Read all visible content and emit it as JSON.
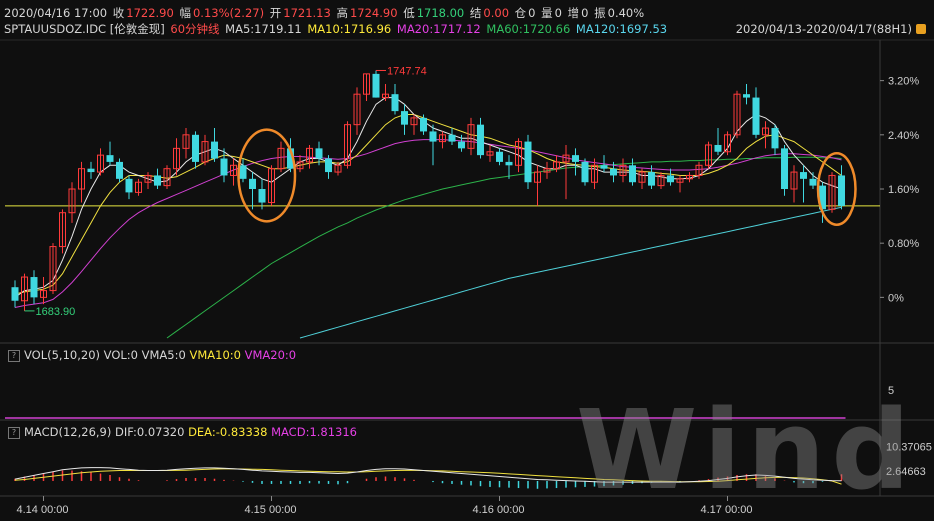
{
  "header": {
    "datetime": "2020/04/16 17:00",
    "close_label": "收",
    "close_value": "1722.90",
    "amp_label": "幅",
    "amp_value": "0.13%(2.27)",
    "open_label": "开",
    "open_value": "1721.13",
    "high_label": "高",
    "high_value": "1724.90",
    "low_label": "低",
    "low_value": "1718.00",
    "settle_label": "结",
    "settle_value": "0.00",
    "oi_label": "仓",
    "oi_value": "0",
    "vol_label": "量",
    "vol_value": "0",
    "inc_label": "增",
    "inc_value": "0",
    "swing_label": "振",
    "swing_value": "0.40%"
  },
  "legend": {
    "symbol": "SPTAUUSDOZ.IDC [伦敦金现]",
    "period": "60分钟线",
    "ma5": "MA5:1719.11",
    "ma10": "MA10:1716.96",
    "ma20": "MA20:1717.12",
    "ma60": "MA60:1720.66",
    "ma120": "MA120:1697.53",
    "range": "2020/04/13-2020/04/17(88H1)"
  },
  "volume_panel": {
    "help": "?",
    "title": "VOL(5,10,20)",
    "vol": "VOL:0",
    "vma5": "VMA5:0",
    "vma10": "VMA10:0",
    "vma20": "VMA20:0",
    "axis_label": "5"
  },
  "macd_panel": {
    "help": "?",
    "title": "MACD(12,26,9)",
    "dif": "DIF:0.07320",
    "dea": "DEA:-0.83338",
    "macd": "MACD:1.81316",
    "axis_top": "10.37065",
    "axis_mid": "2.64663"
  },
  "watermark": "Wind",
  "colors": {
    "up": "#ff3b3b",
    "down": "#40d8e0",
    "ma5": "#e8e8e8",
    "ma10": "#f0e040",
    "ma20": "#d040d0",
    "ma60": "#2cb34a",
    "ma120": "#4fd0d8",
    "ref": "#e8e840",
    "highlight": "#ef8a2a"
  },
  "chart_data": {
    "type": "candlestick",
    "x_tick_labels": [
      "4.14 00:00",
      "4.15 00:00",
      "4.16 00:00",
      "4.17 00:00"
    ],
    "y_tick_labels": [
      "3.20%",
      "2.40%",
      "1.60%",
      "0.80%",
      "0%"
    ],
    "y_range_pct": [
      -0.6,
      3.8
    ],
    "annotations": {
      "high": "1747.74",
      "low": "1683.90"
    },
    "ohlc_pct": [
      [
        0.15,
        0.25,
        -0.15,
        -0.05
      ],
      [
        -0.05,
        0.35,
        -0.2,
        0.3
      ],
      [
        0.3,
        0.4,
        -0.1,
        0.0
      ],
      [
        0.0,
        0.3,
        -0.1,
        0.1
      ],
      [
        0.1,
        0.8,
        0.05,
        0.75
      ],
      [
        0.75,
        1.3,
        0.65,
        1.25
      ],
      [
        1.25,
        1.7,
        1.1,
        1.6
      ],
      [
        1.6,
        2.0,
        1.4,
        1.9
      ],
      [
        1.9,
        2.0,
        1.75,
        1.85
      ],
      [
        1.85,
        2.2,
        1.8,
        2.1
      ],
      [
        2.1,
        2.3,
        1.95,
        2.0
      ],
      [
        2.0,
        2.05,
        1.7,
        1.75
      ],
      [
        1.75,
        1.8,
        1.45,
        1.55
      ],
      [
        1.55,
        1.75,
        1.5,
        1.7
      ],
      [
        1.7,
        1.85,
        1.6,
        1.8
      ],
      [
        1.8,
        1.9,
        1.6,
        1.65
      ],
      [
        1.65,
        1.95,
        1.6,
        1.9
      ],
      [
        1.9,
        2.35,
        1.8,
        2.2
      ],
      [
        2.2,
        2.5,
        2.05,
        2.4
      ],
      [
        2.4,
        2.45,
        1.9,
        2.0
      ],
      [
        2.0,
        2.4,
        1.95,
        2.3
      ],
      [
        2.3,
        2.5,
        2.0,
        2.05
      ],
      [
        2.05,
        2.2,
        1.7,
        1.8
      ],
      [
        1.8,
        2.05,
        1.65,
        1.95
      ],
      [
        1.95,
        2.05,
        1.7,
        1.75
      ],
      [
        1.75,
        1.85,
        1.3,
        1.6
      ],
      [
        1.6,
        1.75,
        1.3,
        1.4
      ],
      [
        1.4,
        1.95,
        1.35,
        1.9
      ],
      [
        1.9,
        2.3,
        1.85,
        2.2
      ],
      [
        2.2,
        2.35,
        1.85,
        1.9
      ],
      [
        1.9,
        2.1,
        1.85,
        2.0
      ],
      [
        2.0,
        2.25,
        1.9,
        2.2
      ],
      [
        2.2,
        2.3,
        1.95,
        2.05
      ],
      [
        2.05,
        2.1,
        1.75,
        1.85
      ],
      [
        1.85,
        2.0,
        1.8,
        1.95
      ],
      [
        1.95,
        2.6,
        1.9,
        2.55
      ],
      [
        2.55,
        3.1,
        2.4,
        3.0
      ],
      [
        3.0,
        3.3,
        2.9,
        3.3
      ],
      [
        3.3,
        3.35,
        2.95,
        2.95
      ],
      [
        2.95,
        3.15,
        2.9,
        3.0
      ],
      [
        3.0,
        3.15,
        2.7,
        2.75
      ],
      [
        2.75,
        2.85,
        2.4,
        2.55
      ],
      [
        2.55,
        2.7,
        2.4,
        2.65
      ],
      [
        2.65,
        2.7,
        2.4,
        2.45
      ],
      [
        2.45,
        2.55,
        1.95,
        2.3
      ],
      [
        2.3,
        2.45,
        2.2,
        2.4
      ],
      [
        2.4,
        2.5,
        2.25,
        2.3
      ],
      [
        2.3,
        2.4,
        2.15,
        2.2
      ],
      [
        2.2,
        2.65,
        2.1,
        2.55
      ],
      [
        2.55,
        2.65,
        2.05,
        2.1
      ],
      [
        2.1,
        2.25,
        2.0,
        2.15
      ],
      [
        2.15,
        2.2,
        1.95,
        2.0
      ],
      [
        2.0,
        2.1,
        1.75,
        1.95
      ],
      [
        1.95,
        2.35,
        1.85,
        2.3
      ],
      [
        2.3,
        2.4,
        1.6,
        1.7
      ],
      [
        1.7,
        1.95,
        1.35,
        1.85
      ],
      [
        1.85,
        2.0,
        1.75,
        1.9
      ],
      [
        1.9,
        2.1,
        1.85,
        2.0
      ],
      [
        2.0,
        2.25,
        1.45,
        2.1
      ],
      [
        2.1,
        2.2,
        1.8,
        2.0
      ],
      [
        2.0,
        2.05,
        1.65,
        1.7
      ],
      [
        1.7,
        2.05,
        1.6,
        1.95
      ],
      [
        1.95,
        2.1,
        1.85,
        1.9
      ],
      [
        1.9,
        2.0,
        1.7,
        1.8
      ],
      [
        1.8,
        2.05,
        1.7,
        1.95
      ],
      [
        1.95,
        2.05,
        1.65,
        1.7
      ],
      [
        1.7,
        1.9,
        1.6,
        1.85
      ],
      [
        1.85,
        1.95,
        1.6,
        1.65
      ],
      [
        1.65,
        1.85,
        1.6,
        1.8
      ],
      [
        1.8,
        1.9,
        1.65,
        1.7
      ],
      [
        1.7,
        1.8,
        1.55,
        1.75
      ],
      [
        1.75,
        1.85,
        1.7,
        1.8
      ],
      [
        1.8,
        2.0,
        1.75,
        1.95
      ],
      [
        1.95,
        2.3,
        1.9,
        2.25
      ],
      [
        2.25,
        2.5,
        2.1,
        2.15
      ],
      [
        2.15,
        2.45,
        2.1,
        2.4
      ],
      [
        2.4,
        3.05,
        2.35,
        3.0
      ],
      [
        3.0,
        3.15,
        2.85,
        2.95
      ],
      [
        2.95,
        3.1,
        2.35,
        2.4
      ],
      [
        2.4,
        2.6,
        2.2,
        2.5
      ],
      [
        2.5,
        2.55,
        2.1,
        2.2
      ],
      [
        2.2,
        2.25,
        1.5,
        1.6
      ],
      [
        1.6,
        1.95,
        1.4,
        1.85
      ],
      [
        1.85,
        1.95,
        1.4,
        1.75
      ],
      [
        1.75,
        1.85,
        1.6,
        1.65
      ],
      [
        1.65,
        1.7,
        1.1,
        1.3
      ],
      [
        1.3,
        1.85,
        1.25,
        1.8
      ],
      [
        1.8,
        1.95,
        1.3,
        1.35
      ]
    ],
    "ma5": [
      0.0,
      0.1,
      0.12,
      0.15,
      0.25,
      0.55,
      0.9,
      1.3,
      1.6,
      1.85,
      1.95,
      1.95,
      1.85,
      1.8,
      1.75,
      1.7,
      1.72,
      1.85,
      2.0,
      2.1,
      2.15,
      2.2,
      2.15,
      2.05,
      1.95,
      1.85,
      1.75,
      1.7,
      1.8,
      1.9,
      2.0,
      2.05,
      2.05,
      2.0,
      1.95,
      2.05,
      2.3,
      2.6,
      2.85,
      2.95,
      2.95,
      2.85,
      2.7,
      2.6,
      2.5,
      2.45,
      2.4,
      2.35,
      2.35,
      2.3,
      2.25,
      2.2,
      2.15,
      2.1,
      2.0,
      1.95,
      1.9,
      1.9,
      1.95,
      1.95,
      1.9,
      1.9,
      1.85,
      1.85,
      1.85,
      1.85,
      1.8,
      1.8,
      1.78,
      1.75,
      1.75,
      1.76,
      1.8,
      1.9,
      2.05,
      2.2,
      2.45,
      2.6,
      2.7,
      2.65,
      2.55,
      2.3,
      2.1,
      1.95,
      1.8,
      1.7,
      1.65,
      1.6
    ],
    "ma10": [
      0.05,
      0.08,
      0.1,
      0.12,
      0.18,
      0.35,
      0.6,
      0.85,
      1.1,
      1.35,
      1.55,
      1.7,
      1.8,
      1.8,
      1.8,
      1.78,
      1.76,
      1.78,
      1.85,
      1.92,
      2.0,
      2.05,
      2.1,
      2.08,
      2.05,
      2.0,
      1.95,
      1.9,
      1.9,
      1.92,
      1.95,
      1.98,
      2.0,
      2.0,
      1.98,
      2.0,
      2.1,
      2.25,
      2.4,
      2.55,
      2.65,
      2.7,
      2.7,
      2.65,
      2.6,
      2.55,
      2.5,
      2.45,
      2.4,
      2.38,
      2.35,
      2.3,
      2.25,
      2.22,
      2.18,
      2.12,
      2.05,
      2.0,
      1.98,
      1.96,
      1.95,
      1.93,
      1.92,
      1.9,
      1.88,
      1.87,
      1.86,
      1.85,
      1.83,
      1.82,
      1.8,
      1.8,
      1.8,
      1.83,
      1.88,
      1.95,
      2.05,
      2.2,
      2.3,
      2.38,
      2.4,
      2.35,
      2.3,
      2.2,
      2.1,
      2.0,
      1.9,
      1.8
    ],
    "ma20": [
      -0.15,
      -0.12,
      -0.1,
      -0.08,
      -0.03,
      0.08,
      0.22,
      0.38,
      0.55,
      0.72,
      0.88,
      1.02,
      1.15,
      1.25,
      1.33,
      1.4,
      1.46,
      1.52,
      1.58,
      1.64,
      1.7,
      1.76,
      1.82,
      1.88,
      1.93,
      1.98,
      2.02,
      2.05,
      2.07,
      2.08,
      2.08,
      2.07,
      2.06,
      2.05,
      2.04,
      2.05,
      2.08,
      2.12,
      2.17,
      2.22,
      2.27,
      2.3,
      2.32,
      2.33,
      2.33,
      2.33,
      2.32,
      2.31,
      2.3,
      2.28,
      2.26,
      2.24,
      2.22,
      2.2,
      2.18,
      2.15,
      2.12,
      2.09,
      2.06,
      2.03,
      2.01,
      1.99,
      1.97,
      1.95,
      1.93,
      1.92,
      1.91,
      1.9,
      1.89,
      1.88,
      1.88,
      1.88,
      1.89,
      1.9,
      1.92,
      1.95,
      1.98,
      2.02,
      2.06,
      2.09,
      2.11,
      2.12,
      2.12,
      2.11,
      2.1,
      2.08,
      2.06,
      2.03
    ],
    "ma60": [
      null,
      null,
      null,
      null,
      null,
      null,
      null,
      null,
      null,
      null,
      null,
      null,
      null,
      null,
      null,
      null,
      -0.6,
      -0.5,
      -0.4,
      -0.3,
      -0.2,
      -0.1,
      0.0,
      0.1,
      0.2,
      0.3,
      0.4,
      0.5,
      0.58,
      0.66,
      0.74,
      0.82,
      0.9,
      0.97,
      1.04,
      1.1,
      1.17,
      1.23,
      1.29,
      1.34,
      1.39,
      1.44,
      1.48,
      1.52,
      1.56,
      1.6,
      1.63,
      1.66,
      1.69,
      1.72,
      1.75,
      1.77,
      1.79,
      1.81,
      1.83,
      1.85,
      1.87,
      1.89,
      1.91,
      1.92,
      1.93,
      1.94,
      1.95,
      1.96,
      1.97,
      1.98,
      1.99,
      2.0,
      2.0,
      2.01,
      2.01,
      2.02,
      2.02,
      2.03,
      2.03,
      2.04,
      2.04,
      2.05,
      2.05,
      2.06,
      2.06,
      2.06,
      2.07,
      2.07,
      2.07,
      2.06,
      2.06,
      2.05
    ],
    "ma120": [
      null,
      null,
      null,
      null,
      null,
      null,
      null,
      null,
      null,
      null,
      null,
      null,
      null,
      null,
      null,
      null,
      null,
      null,
      null,
      null,
      null,
      null,
      null,
      null,
      null,
      null,
      null,
      null,
      null,
      null,
      -0.6,
      -0.56,
      -0.52,
      -0.48,
      -0.44,
      -0.4,
      -0.36,
      -0.32,
      -0.28,
      -0.24,
      -0.2,
      -0.16,
      -0.12,
      -0.08,
      -0.04,
      0.0,
      0.04,
      0.08,
      0.12,
      0.16,
      0.2,
      0.24,
      0.28,
      0.31,
      0.34,
      0.37,
      0.4,
      0.43,
      0.46,
      0.49,
      0.52,
      0.55,
      0.58,
      0.61,
      0.64,
      0.67,
      0.7,
      0.73,
      0.76,
      0.79,
      0.82,
      0.85,
      0.88,
      0.91,
      0.94,
      0.97,
      1.0,
      1.03,
      1.06,
      1.09,
      1.12,
      1.15,
      1.18,
      1.21,
      1.24,
      1.27,
      1.3,
      1.33
    ],
    "ref_level_pct": 1.35,
    "volume": {
      "ylim": [
        0,
        10
      ],
      "vma_level": 0
    },
    "macd": {
      "ylim": [
        -3.5,
        11
      ],
      "dif": [
        0.5,
        1.0,
        1.5,
        2.0,
        2.5,
        3.0,
        3.3,
        3.5,
        3.6,
        3.6,
        3.5,
        3.3,
        3.1,
        2.9,
        2.8,
        2.8,
        2.9,
        3.1,
        3.3,
        3.4,
        3.5,
        3.5,
        3.4,
        3.3,
        3.1,
        2.9,
        2.7,
        2.6,
        2.5,
        2.4,
        2.3,
        2.3,
        2.2,
        2.1,
        2.0,
        2.1,
        2.4,
        2.8,
        3.1,
        3.3,
        3.3,
        3.2,
        3.0,
        2.8,
        2.6,
        2.4,
        2.2,
        2.0,
        1.8,
        1.6,
        1.4,
        1.2,
        1.0,
        0.8,
        0.6,
        0.4,
        0.3,
        0.2,
        0.1,
        0.0,
        -0.1,
        -0.2,
        -0.3,
        -0.3,
        -0.3,
        -0.3,
        -0.3,
        -0.3,
        -0.3,
        -0.3,
        -0.3,
        -0.2,
        -0.1,
        0.1,
        0.4,
        0.7,
        1.1,
        1.4,
        1.6,
        1.5,
        1.3,
        1.0,
        0.7,
        0.5,
        0.3,
        0.2,
        0.1,
        0.07
      ],
      "dea": [
        0.2,
        0.4,
        0.7,
        1.0,
        1.3,
        1.6,
        1.9,
        2.2,
        2.4,
        2.6,
        2.7,
        2.8,
        2.8,
        2.8,
        2.8,
        2.8,
        2.8,
        2.85,
        2.9,
        3.0,
        3.1,
        3.2,
        3.25,
        3.25,
        3.2,
        3.15,
        3.1,
        3.0,
        2.9,
        2.8,
        2.7,
        2.6,
        2.55,
        2.5,
        2.45,
        2.4,
        2.4,
        2.5,
        2.6,
        2.7,
        2.8,
        2.85,
        2.85,
        2.8,
        2.75,
        2.7,
        2.6,
        2.5,
        2.4,
        2.3,
        2.2,
        2.05,
        1.9,
        1.75,
        1.6,
        1.45,
        1.3,
        1.15,
        1.0,
        0.85,
        0.7,
        0.55,
        0.4,
        0.3,
        0.2,
        0.1,
        0.0,
        -0.05,
        -0.1,
        -0.15,
        -0.2,
        -0.2,
        -0.2,
        -0.15,
        -0.05,
        0.1,
        0.3,
        0.5,
        0.7,
        0.85,
        0.95,
        0.95,
        0.9,
        0.8,
        0.6,
        0.3,
        0.0,
        -0.83
      ],
      "hist": [
        0.6,
        1.2,
        1.6,
        2.0,
        2.4,
        2.8,
        2.8,
        2.6,
        2.4,
        2.0,
        1.6,
        1.0,
        0.6,
        0.2,
        0.0,
        0.0,
        0.2,
        0.5,
        0.8,
        0.8,
        0.8,
        0.6,
        0.3,
        0.1,
        -0.2,
        -0.5,
        -0.8,
        -0.8,
        -0.8,
        -0.8,
        -0.8,
        -0.6,
        -0.7,
        -0.8,
        -0.9,
        -0.6,
        0.0,
        0.6,
        1.0,
        1.2,
        1.0,
        0.7,
        0.3,
        0.0,
        -0.3,
        -0.6,
        -0.8,
        -1.0,
        -1.2,
        -1.4,
        -1.6,
        -1.7,
        -1.8,
        -1.9,
        -2.0,
        -2.1,
        -2.0,
        -1.9,
        -1.8,
        -1.7,
        -1.6,
        -1.5,
        -1.4,
        -1.2,
        -1.0,
        -0.8,
        -0.6,
        -0.5,
        -0.4,
        -0.3,
        -0.2,
        0.0,
        0.2,
        0.5,
        0.9,
        1.2,
        1.6,
        1.8,
        1.8,
        1.3,
        0.7,
        0.1,
        -0.4,
        -0.6,
        -0.6,
        -0.2,
        0.2,
        1.8
      ]
    }
  }
}
